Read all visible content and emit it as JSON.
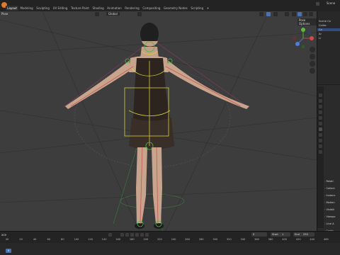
{
  "topbar": {
    "tabs": [
      {
        "label": "Layout",
        "active": true
      },
      {
        "label": "Modeling",
        "active": false
      },
      {
        "label": "Sculpting",
        "active": false
      },
      {
        "label": "UV Editing",
        "active": false
      },
      {
        "label": "Texture Paint",
        "active": false
      },
      {
        "label": "Shading",
        "active": false
      },
      {
        "label": "Animation",
        "active": false
      },
      {
        "label": "Rendering",
        "active": false
      },
      {
        "label": "Compositing",
        "active": false
      },
      {
        "label": "Geometry Nodes",
        "active": false
      },
      {
        "label": "Scripting",
        "active": false
      }
    ],
    "add_tab": "+",
    "scene_label": "Scene"
  },
  "viewport": {
    "mode": "Pose",
    "pivot": "Global",
    "pose_options": "Pose Options",
    "accent_color": "#4772b3"
  },
  "outliner": {
    "rows": [
      "Scene Co",
      "Collec",
      "Ca",
      "Ar",
      "Li"
    ]
  },
  "properties": {
    "panel_rows": [
      "Relati",
      "Collect",
      "Instanc",
      "Motion",
      "Visibili",
      "Viewpo",
      "Line A",
      "Custo"
    ]
  },
  "timeline": {
    "label": "ace",
    "current_frame": "0",
    "start_label": "Start",
    "start_value": "1",
    "end_label": "End",
    "end_value": "250",
    "ticks": [
      "40",
      "20",
      "40",
      "60",
      "80",
      "100",
      "120",
      "140",
      "160",
      "180",
      "200",
      "220",
      "240",
      "260",
      "280",
      "300",
      "320",
      "340",
      "360",
      "380",
      "400",
      "420",
      "440",
      "460"
    ]
  }
}
